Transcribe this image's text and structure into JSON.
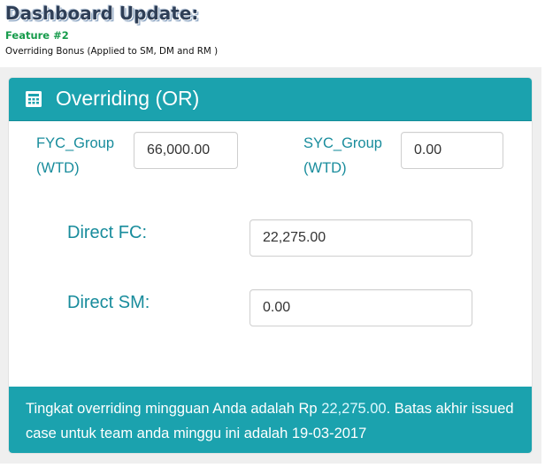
{
  "header": {
    "title": "Dashboard Update:",
    "feature": "Feature #2",
    "description": "Overriding Bonus (Applied to SM, DM and RM )"
  },
  "card": {
    "icon": "calculator-icon",
    "title": "Overriding (OR)",
    "fyc_label_line1": "FYC_Group",
    "fyc_label_line2": "(WTD)",
    "fyc_value": "66,000.00",
    "syc_label_line1": "SYC_Group",
    "syc_label_line2": "(WTD)",
    "syc_value": "0.00",
    "direct_fc_label": "Direct FC:",
    "direct_fc_value": "22,275.00",
    "direct_sm_label": "Direct SM:",
    "direct_sm_value": "0.00"
  },
  "footer": {
    "text_before_amount": "Tingkat overriding mingguan Anda adalah Rp ",
    "amount": "22,275.00",
    "text_after_amount": ". Batas akhir issued case untuk team anda minggu ini adalah 19-03-2017"
  },
  "colors": {
    "accent": "#1ba2ae",
    "label": "#188c9c",
    "feature": "#169b4b"
  }
}
